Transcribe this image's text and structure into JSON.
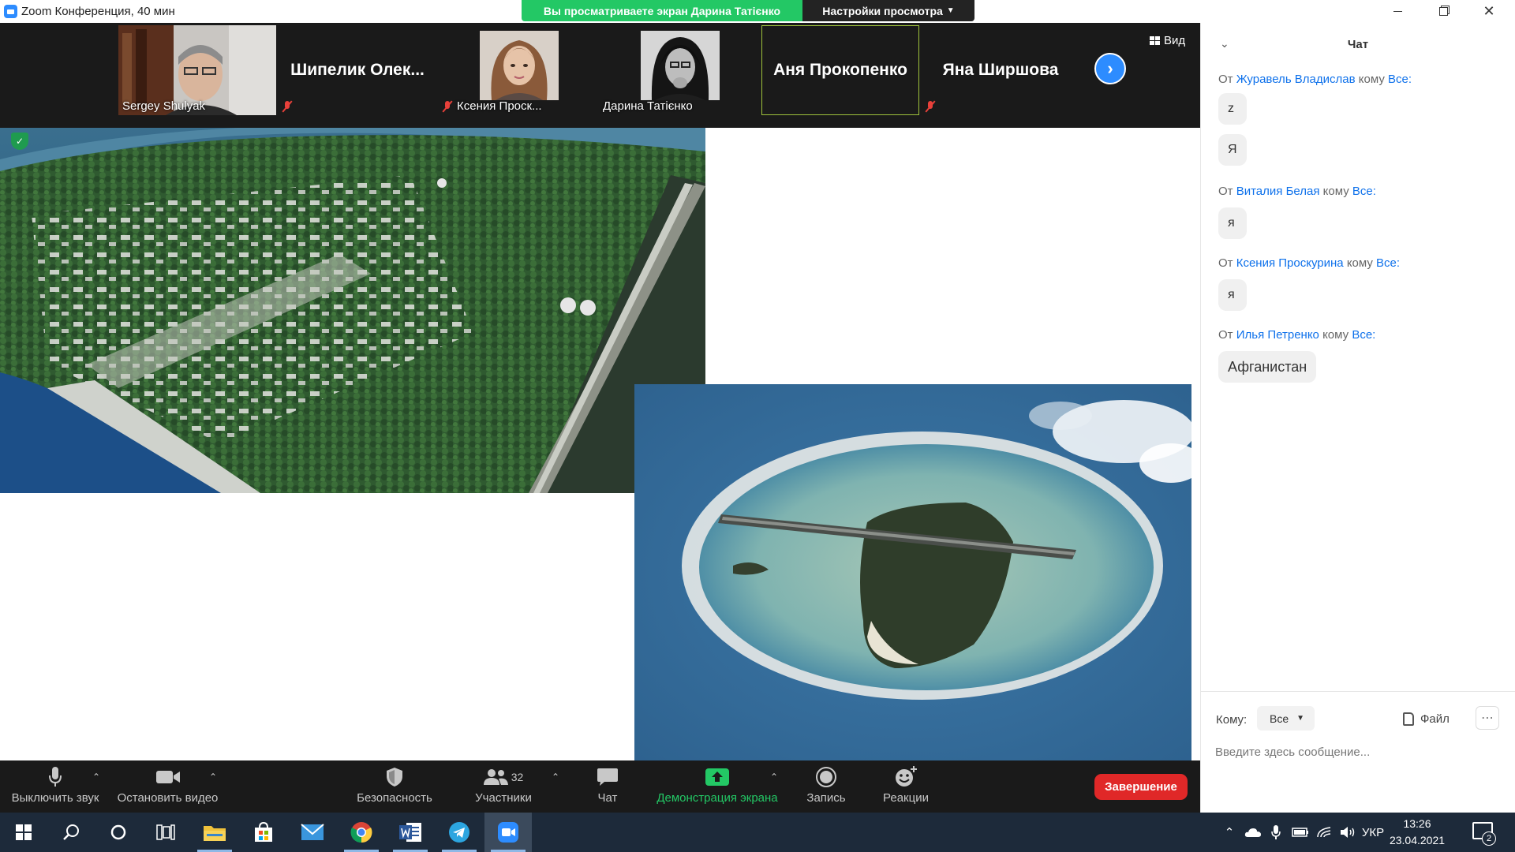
{
  "window": {
    "title": "Zoom Конференция, 40 мин",
    "share_banner": "Вы просматриваете экран Дарина Татієнко",
    "view_settings": "Настройки просмотра"
  },
  "video_strip": {
    "participants": [
      {
        "name": "Sergey Shulyak",
        "muted": false
      },
      {
        "name": "Шипелик  Олек...",
        "muted": true
      },
      {
        "name": "Ксения Проск...",
        "muted": true
      },
      {
        "name": "Дарина Татієнко",
        "muted": false
      },
      {
        "name": "Аня Прокопенко",
        "muted": false,
        "active_speaker": true
      },
      {
        "name": "Яна Ширшова",
        "muted": true
      }
    ],
    "view_label": "Вид"
  },
  "toolbar": {
    "mute_label": "Выключить звук",
    "video_label": "Остановить видео",
    "security_label": "Безопасность",
    "participants_label": "Участники",
    "participants_count": "32",
    "chat_label": "Чат",
    "share_label": "Демонстрация экрана",
    "record_label": "Запись",
    "reactions_label": "Реакции",
    "end_label": "Завершение"
  },
  "chat": {
    "title": "Чат",
    "from_prefix": "От",
    "to_word": "кому",
    "everyone": "Все:",
    "messages": [
      {
        "sender": "Журавель Владислав",
        "lines": [
          "z",
          "Я"
        ]
      },
      {
        "sender": "Виталия Белая",
        "lines": [
          "я"
        ]
      },
      {
        "sender": "Ксения Проскурина",
        "lines": [
          "я"
        ]
      },
      {
        "sender": "Илья Петренко",
        "lines": [
          "Афганистан"
        ]
      }
    ],
    "to_label": "Кому:",
    "to_value": "Все",
    "file_label": "Файл",
    "input_placeholder": "Введите здесь сообщение..."
  },
  "taskbar": {
    "language": "УКР",
    "time": "13:26",
    "date": "23.04.2021",
    "notifications": "2",
    "pinned_apps": [
      "windows-start",
      "search",
      "cortana",
      "task-view",
      "file-explorer",
      "microsoft-store",
      "mail",
      "chrome",
      "word",
      "telegram",
      "zoom"
    ]
  },
  "colors": {
    "zoom_blue": "#2d8cff",
    "share_green": "#23c865",
    "end_red": "#e02828",
    "toolbar_bg": "#1a1a1a",
    "taskbar_bg": "#1d2a3a",
    "chat_link": "#0e71eb"
  }
}
